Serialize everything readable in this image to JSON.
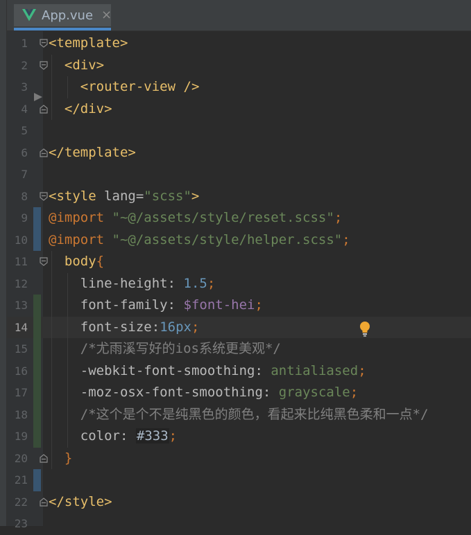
{
  "tab": {
    "label": "App.vue",
    "close_glyph": "×",
    "icon": "vue-logo-icon"
  },
  "colors": {
    "background": "#2b2b2b",
    "gutter": "#313335",
    "tag": "#e8bf6a",
    "string": "#6a8759",
    "number": "#6897bb",
    "keyword": "#cc7832",
    "variable": "#9876aa",
    "comment": "#808080",
    "vcs_modified": "#385570",
    "vcs_added": "#384c38"
  },
  "editor": {
    "current_line": 14,
    "lines": [
      {
        "n": "1",
        "vcs": "",
        "t": [
          "<template>"
        ]
      },
      {
        "n": "2",
        "vcs": "",
        "t": [
          "<div>"
        ]
      },
      {
        "n": "3",
        "vcs": "",
        "t": [
          "<router-view />"
        ]
      },
      {
        "n": "4",
        "vcs": "",
        "t": [
          "</div>"
        ]
      },
      {
        "n": "5",
        "vcs": "",
        "t": []
      },
      {
        "n": "6",
        "vcs": "",
        "t": [
          "</template>"
        ]
      },
      {
        "n": "7",
        "vcs": "",
        "t": []
      },
      {
        "n": "8",
        "vcs": "",
        "t": [
          "<style ",
          "lang=",
          "\"scss\"",
          ">"
        ]
      },
      {
        "n": "9",
        "vcs": "mod",
        "t": [
          "@import ",
          "\"~@/assets/style/reset.scss\"",
          ";"
        ]
      },
      {
        "n": "10",
        "vcs": "mod",
        "t": [
          "@import ",
          "\"~@/assets/style/helper.scss\"",
          ";"
        ]
      },
      {
        "n": "11",
        "vcs": "",
        "t": [
          "body",
          "{"
        ]
      },
      {
        "n": "12",
        "vcs": "",
        "t": [
          "line-height",
          ": ",
          "1.5",
          ";"
        ]
      },
      {
        "n": "13",
        "vcs": "add",
        "t": [
          "font-family",
          ": ",
          "$font-hei",
          ";"
        ]
      },
      {
        "n": "14",
        "vcs": "add",
        "t": [
          "font-size",
          ":",
          "16px",
          ";"
        ]
      },
      {
        "n": "15",
        "vcs": "add",
        "t": [
          "/*尤雨溪写好的ios系统更美观*/"
        ]
      },
      {
        "n": "16",
        "vcs": "add",
        "t": [
          "-webkit-font-smoothing",
          ": ",
          "antialiased",
          ";"
        ]
      },
      {
        "n": "17",
        "vcs": "add",
        "t": [
          "-moz-osx-font-smoothing",
          ": ",
          "grayscale",
          ";"
        ]
      },
      {
        "n": "18",
        "vcs": "add",
        "t": [
          "/*这个是个不是纯黑色的颜色，看起来比纯黑色柔和一点*/"
        ]
      },
      {
        "n": "19",
        "vcs": "add",
        "t": [
          "color",
          ": ",
          "#333",
          ";"
        ]
      },
      {
        "n": "20",
        "vcs": "",
        "t": [
          "}"
        ]
      },
      {
        "n": "21",
        "vcs": "mod",
        "t": []
      },
      {
        "n": "22",
        "vcs": "",
        "t": [
          "</style>"
        ]
      },
      {
        "n": "23",
        "vcs": "",
        "t": []
      }
    ]
  }
}
